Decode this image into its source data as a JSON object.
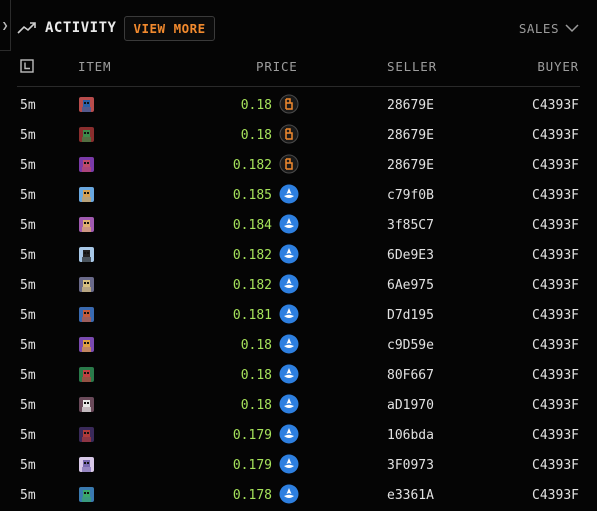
{
  "header": {
    "title": "ACTIVITY",
    "view_more": "VIEW MORE",
    "filter": "SALES"
  },
  "columns": {
    "item": "ITEM",
    "price": "PRICE",
    "seller": "SELLER",
    "buyer": "BUYER"
  },
  "colors": {
    "accent": "#f28a2e",
    "price_green": "#a6e35b",
    "token_blue": "#2d7fe0"
  },
  "rows": [
    {
      "time": "5m",
      "price": "0.18",
      "currency": "orange-token-icon",
      "seller": "28679E",
      "buyer": "C4393F",
      "thumb": [
        "#b84c4c",
        "#2a5fa8"
      ]
    },
    {
      "time": "5m",
      "price": "0.18",
      "currency": "orange-token-icon",
      "seller": "28679E",
      "buyer": "C4393F",
      "thumb": [
        "#8a2e2e",
        "#3c8a4a"
      ]
    },
    {
      "time": "5m",
      "price": "0.182",
      "currency": "orange-token-icon",
      "seller": "28679E",
      "buyer": "C4393F",
      "thumb": [
        "#7a3aa8",
        "#c04a6a"
      ]
    },
    {
      "time": "5m",
      "price": "0.185",
      "currency": "blue-token-icon",
      "seller": "c79f0B",
      "buyer": "C4393F",
      "thumb": [
        "#6aa8e0",
        "#d8a050"
      ]
    },
    {
      "time": "5m",
      "price": "0.184",
      "currency": "blue-token-icon",
      "seller": "3f85C7",
      "buyer": "C4393F",
      "thumb": [
        "#a05ab0",
        "#e0b070"
      ]
    },
    {
      "time": "5m",
      "price": "0.182",
      "currency": "blue-token-icon",
      "seller": "6De9E3",
      "buyer": "C4393F",
      "thumb": [
        "#a8c8e8",
        "#222222"
      ]
    },
    {
      "time": "5m",
      "price": "0.182",
      "currency": "blue-token-icon",
      "seller": "6Ae975",
      "buyer": "C4393F",
      "thumb": [
        "#6a6a8a",
        "#d8c080"
      ]
    },
    {
      "time": "5m",
      "price": "0.181",
      "currency": "blue-token-icon",
      "seller": "D7d195",
      "buyer": "C4393F",
      "thumb": [
        "#3a6ab0",
        "#c85a3a"
      ]
    },
    {
      "time": "5m",
      "price": "0.18",
      "currency": "blue-token-icon",
      "seller": "c9D59e",
      "buyer": "C4393F",
      "thumb": [
        "#7a4ab0",
        "#e0a040"
      ]
    },
    {
      "time": "5m",
      "price": "0.18",
      "currency": "blue-token-icon",
      "seller": "80F667",
      "buyer": "C4393F",
      "thumb": [
        "#2a7a4a",
        "#c04040"
      ]
    },
    {
      "time": "5m",
      "price": "0.18",
      "currency": "blue-token-icon",
      "seller": "aD1970",
      "buyer": "C4393F",
      "thumb": [
        "#6a4a5a",
        "#e8e8e8"
      ]
    },
    {
      "time": "5m",
      "price": "0.179",
      "currency": "blue-token-icon",
      "seller": "106bda",
      "buyer": "C4393F",
      "thumb": [
        "#3a2a5a",
        "#b03a3a"
      ]
    },
    {
      "time": "5m",
      "price": "0.179",
      "currency": "blue-token-icon",
      "seller": "3F0973",
      "buyer": "C4393F",
      "thumb": [
        "#d8c8e8",
        "#7a6ab0"
      ]
    },
    {
      "time": "5m",
      "price": "0.178",
      "currency": "blue-token-icon",
      "seller": "e3361A",
      "buyer": "C4393F",
      "thumb": [
        "#3a7ab0",
        "#3aa86a"
      ]
    }
  ]
}
